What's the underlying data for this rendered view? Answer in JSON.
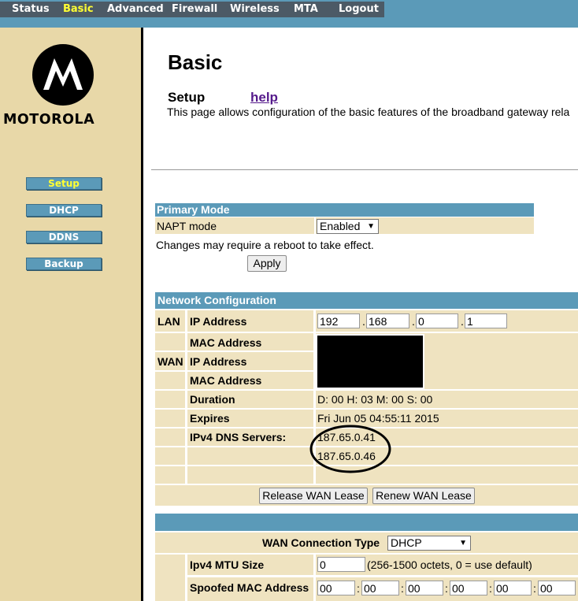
{
  "nav": {
    "items": [
      "Status",
      "Basic",
      "Advanced",
      "Firewall",
      "Wireless",
      "MTA",
      "Logout"
    ],
    "active": "Basic"
  },
  "brand": {
    "name": "MOTOROLA"
  },
  "sidebar": {
    "items": [
      "Setup",
      "DHCP",
      "DDNS",
      "Backup"
    ],
    "active": "Setup"
  },
  "page": {
    "title": "Basic",
    "section": "Setup",
    "help": "help",
    "description": "This page allows configuration of the basic features of the broadband gateway rela"
  },
  "primary_mode": {
    "header": "Primary Mode",
    "napt_label": "NAPT mode",
    "napt_value": "Enabled",
    "note": "Changes may require a reboot to take effect.",
    "apply": "Apply"
  },
  "network": {
    "header": "Network Configuration",
    "lan": "LAN",
    "wan": "WAN",
    "ip_label": "IP Address",
    "mac_label": "MAC Address",
    "lan_ip": [
      "192",
      "168",
      "0",
      "1"
    ],
    "duration_label": "Duration",
    "duration_value": "D: 00 H: 03 M: 00 S: 00",
    "expires_label": "Expires",
    "expires_value": "Fri Jun 05 04:55:11 2015",
    "dns_label": "IPv4 DNS Servers:",
    "dns": [
      "187.65.0.41",
      "187.65.0.46"
    ],
    "release": "Release WAN Lease",
    "renew": "Renew WAN Lease"
  },
  "wan_conn": {
    "type_label": "WAN Connection Type",
    "type_value": "DHCP",
    "mtu_label": "Ipv4 MTU Size",
    "mtu_value": "0",
    "mtu_hint": "(256-1500 octets, 0 = use default)",
    "spoof_label": "Spoofed MAC Address",
    "spoof_values": [
      "00",
      "00",
      "00",
      "00",
      "00",
      "00"
    ]
  },
  "colors": {
    "nav_bg": "#5b9ab8",
    "sidebar_bg": "#e8d8a8",
    "row_bg": "#efe3c0",
    "active_text": "#ffff33"
  }
}
